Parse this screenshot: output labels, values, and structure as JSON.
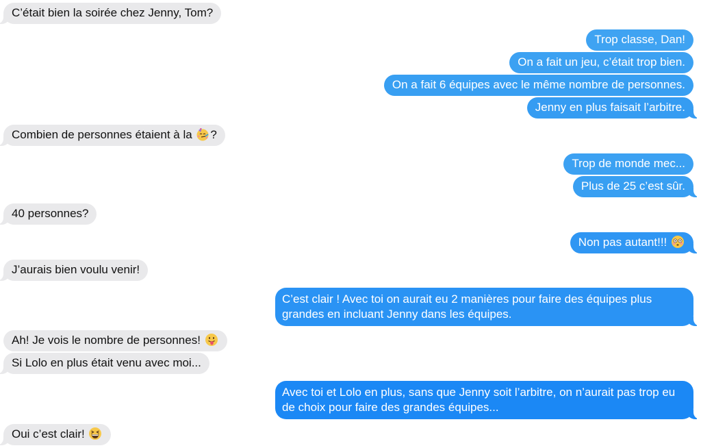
{
  "colors": {
    "incoming_bubble": "#e9e9eb",
    "incoming_text": "#111111",
    "outgoing_light": "#3fa3f2",
    "outgoing_dark": "#1b88f5",
    "outgoing_text": "#ffffff"
  },
  "messages": [
    {
      "direction": "in",
      "text": "C’était bien la soirée chez Jenny, Tom?"
    },
    {
      "direction": "out",
      "text": "Trop classe, Dan!"
    },
    {
      "direction": "out",
      "text": "On a fait un jeu, c’était trop bien."
    },
    {
      "direction": "out",
      "text": "On a fait 6 équipes avec le même nombre de personnes."
    },
    {
      "direction": "out",
      "text": "Jenny en plus faisait l’arbitre."
    },
    {
      "direction": "in",
      "text_before": "Combien de personnes étaient à la ",
      "emoji": "partying-face-emoji",
      "text_after": "?"
    },
    {
      "direction": "out",
      "text": "Trop de monde mec..."
    },
    {
      "direction": "out",
      "text": "Plus de 25 c’est sûr."
    },
    {
      "direction": "in",
      "text": "40 personnes?"
    },
    {
      "direction": "out",
      "text_before": "Non pas autant!!! ",
      "emoji": "flushed-face-emoji"
    },
    {
      "direction": "in",
      "text": "J’aurais bien voulu venir!"
    },
    {
      "direction": "out",
      "text": "C’est clair ! Avec toi on aurait eu 2 manières pour faire des équipes plus grandes en incluant Jenny dans les équipes."
    },
    {
      "direction": "in",
      "text_before": "Ah! Je vois le nombre de personnes! ",
      "emoji": "tongue-out-face-emoji"
    },
    {
      "direction": "in",
      "text": "Si Lolo en plus était venu avec moi..."
    },
    {
      "direction": "out",
      "text": "Avec toi et Lolo en plus, sans que Jenny soit l’arbitre, on n’aurait pas trop eu de choix pour faire des grandes équipes..."
    },
    {
      "direction": "in",
      "text_before": "Oui c’est clair! ",
      "emoji": "grinning-squinting-face-emoji"
    }
  ]
}
